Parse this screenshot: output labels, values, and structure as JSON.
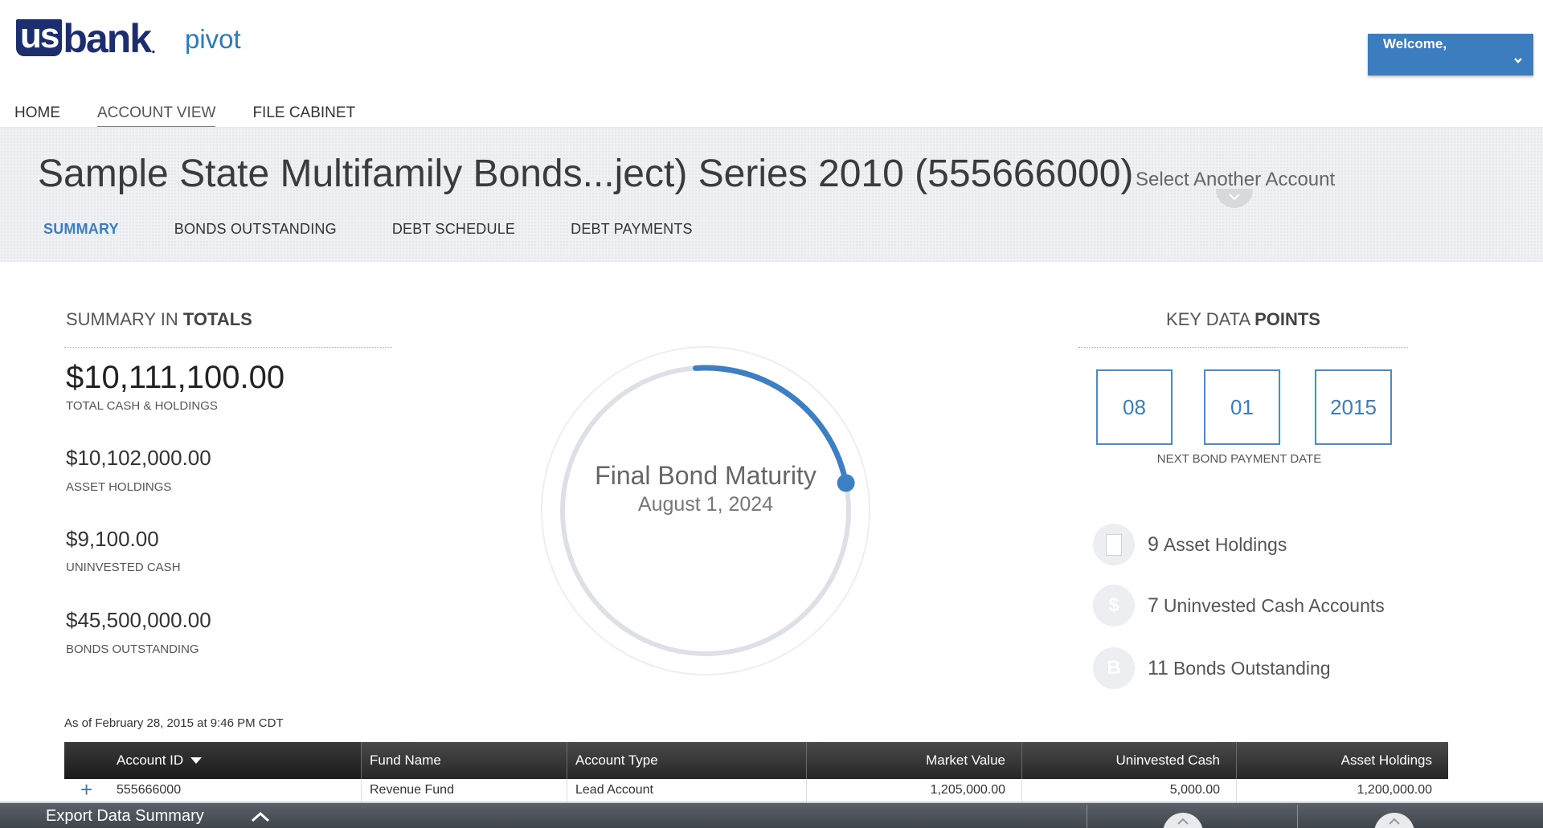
{
  "header": {
    "logo_us": "us",
    "logo_bank": "bank",
    "logo_dot": ".",
    "logo_product": "pivot",
    "welcome_label": "Welcome,"
  },
  "nav": {
    "items": [
      {
        "label": "HOME",
        "active": false
      },
      {
        "label": "ACCOUNT VIEW",
        "active": true
      },
      {
        "label": "FILE CABINET",
        "active": false
      }
    ]
  },
  "account": {
    "title": "Sample State Multifamily Bonds...ject) Series 2010 (555666000)",
    "select_another": "Select Another Account"
  },
  "subtabs": [
    {
      "label": "SUMMARY",
      "active": true
    },
    {
      "label": "BONDS OUTSTANDING",
      "active": false
    },
    {
      "label": "DEBT SCHEDULE",
      "active": false
    },
    {
      "label": "DEBT PAYMENTS",
      "active": false
    }
  ],
  "summary": {
    "heading_prefix": "SUMMARY IN ",
    "heading_bold": "TOTALS",
    "total_amount": "$10,111,100.00",
    "total_label": "TOTAL CASH & HOLDINGS",
    "asset_holdings_amount": "$10,102,000.00",
    "asset_holdings_label": "ASSET HOLDINGS",
    "uninvested_cash_amount": "$9,100.00",
    "uninvested_cash_label": "UNINVESTED CASH",
    "bonds_outstanding_amount": "$45,500,000.00",
    "bonds_outstanding_label": "BONDS OUTSTANDING"
  },
  "maturity": {
    "title": "Final Bond Maturity",
    "date": "August 1, 2024",
    "progress_fraction": 0.23
  },
  "key_data": {
    "heading_prefix": "KEY DATA ",
    "heading_bold": "POINTS",
    "month": "08",
    "day": "01",
    "year": "2015",
    "date_caption": "NEXT BOND PAYMENT DATE",
    "points": [
      {
        "icon": "document-icon",
        "count": "9",
        "label": "Asset Holdings"
      },
      {
        "icon": "dollar-icon",
        "glyph": "$",
        "count": "7",
        "label": "Uninvested Cash Accounts"
      },
      {
        "icon": "bond-icon",
        "glyph": "B",
        "count": "11",
        "label": "Bonds Outstanding"
      }
    ]
  },
  "table": {
    "as_of": "As of February 28, 2015 at 9:46 PM CDT",
    "columns": [
      "Account ID",
      "Fund Name",
      "Account Type",
      "Market Value",
      "Uninvested Cash",
      "Asset Holdings"
    ],
    "rows": [
      [
        "555666000",
        "Revenue Fund",
        "Lead Account",
        "1,205,000.00",
        "5,000.00",
        "1,200,000.00"
      ]
    ],
    "expand_glyph": "+"
  },
  "export_bar": {
    "label": "Export Data Summary"
  },
  "colors": {
    "brand_navy": "#1d2e6e",
    "accent_blue": "#3c7dbf",
    "progress_arc": "#3d7fc3"
  }
}
